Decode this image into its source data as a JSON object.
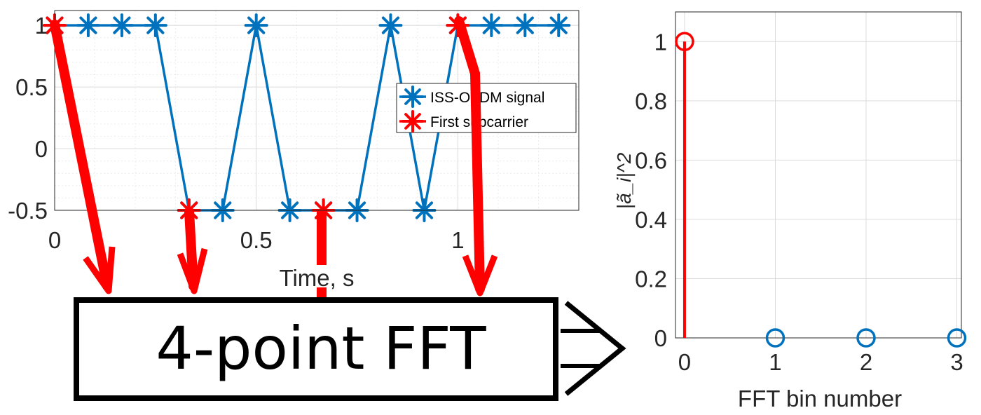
{
  "time_plot": {
    "xlabel": "Time, s",
    "x_ticks": [
      "0",
      "0.5",
      "1"
    ],
    "y_ticks": [
      "1",
      "0.5",
      "0",
      "-0.5"
    ],
    "legend": {
      "position": "right",
      "entries": [
        "ISS-OFDM signal",
        "First subcarrier"
      ]
    }
  },
  "fft_block": {
    "label": "4-point FFT"
  },
  "spectrum_plot": {
    "xlabel": "FFT bin number",
    "ylabel": "|ã_i|^2",
    "x_ticks": [
      "0",
      "1",
      "2",
      "3"
    ],
    "y_ticks": [
      "1",
      "0.8",
      "0.6",
      "0.4",
      "0.2",
      "0"
    ]
  },
  "colors": {
    "signal": "#0072BD",
    "subcarrier": "#FF0000",
    "axes": "#262626"
  },
  "chart_data": [
    {
      "type": "line",
      "xlabel": "Time, s",
      "ylabel": "",
      "xlim": [
        0,
        1.3
      ],
      "ylim": [
        -0.5,
        1
      ],
      "grid": true,
      "legend_position": "right",
      "series": [
        {
          "name": "ISS-OFDM signal",
          "color": "#0072BD",
          "x": [
            0,
            0.0833,
            0.1667,
            0.25,
            0.3333,
            0.4167,
            0.5,
            0.5833,
            0.6667,
            0.75,
            0.8333,
            0.9167,
            1.0,
            1.0833,
            1.1667,
            1.25
          ],
          "y": [
            1,
            1,
            1,
            1,
            -0.5,
            -0.5,
            1,
            -0.5,
            -0.5,
            -0.5,
            1,
            -0.5,
            1,
            1,
            1,
            1
          ]
        },
        {
          "name": "First subcarrier",
          "color": "#FF0000",
          "x": [
            0,
            0.3333,
            0.6667,
            1.0
          ],
          "y": [
            1,
            -0.5,
            -0.5,
            1
          ]
        }
      ]
    },
    {
      "type": "stem",
      "xlabel": "FFT bin number",
      "ylabel": "|ã_i|^2",
      "xlim": [
        -0.1,
        3.05
      ],
      "ylim": [
        0,
        1.1
      ],
      "grid": true,
      "series": [
        {
          "name": "",
          "color": "#FF0000",
          "x": [
            0
          ],
          "y": [
            1
          ]
        },
        {
          "name": "",
          "color": "#0072BD",
          "x": [
            1,
            2,
            3
          ],
          "y": [
            0,
            0,
            0
          ]
        }
      ]
    }
  ]
}
